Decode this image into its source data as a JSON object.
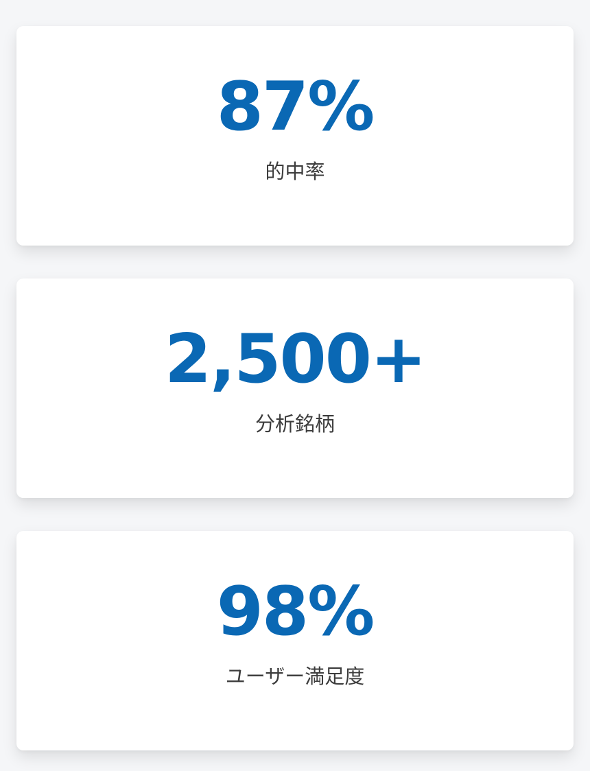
{
  "theme": {
    "accent_color": "#0a68b4",
    "label_color": "#3d3d3d",
    "card_background": "#ffffff",
    "page_background": "#f5f6f8"
  },
  "stats": [
    {
      "value": "87%",
      "label": "的中率"
    },
    {
      "value": "2,500+",
      "label": "分析銘柄"
    },
    {
      "value": "98%",
      "label": "ユーザー満足度"
    }
  ]
}
